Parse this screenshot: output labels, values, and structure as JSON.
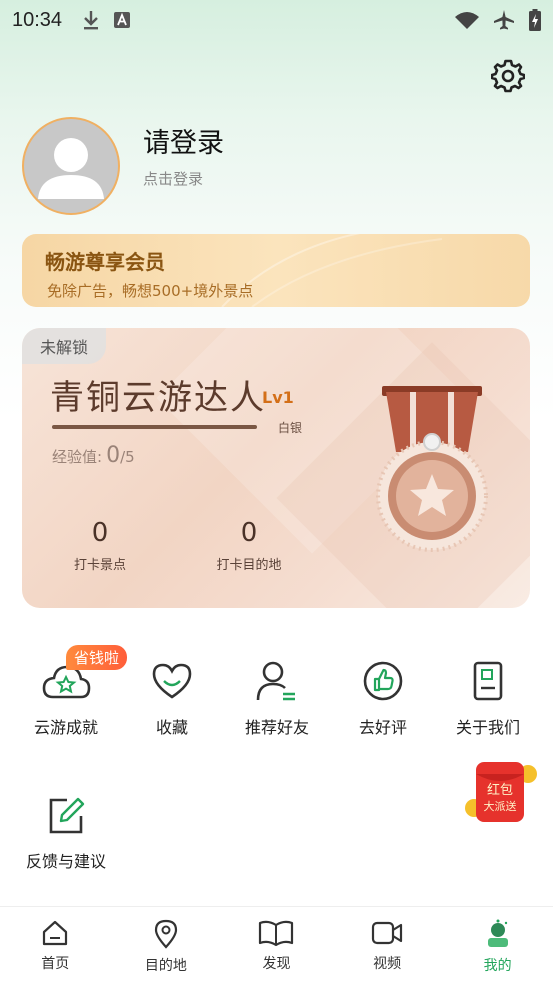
{
  "status_bar": {
    "time": "10:34"
  },
  "profile": {
    "title": "请登录",
    "subtitle": "点击登录"
  },
  "vip": {
    "title": "畅游尊享会员",
    "subtitle": "免除广告，畅想500+境外景点"
  },
  "badge": {
    "locked_label": "未解锁",
    "title": "青铜云游达人",
    "level": "Lv1",
    "next_level": "白银",
    "exp_label": "经验值:",
    "exp_value": "0",
    "exp_max": "/5",
    "progress": 0,
    "stats": [
      {
        "value": "0",
        "label": "打卡景点"
      },
      {
        "value": "0",
        "label": "打卡目的地"
      }
    ]
  },
  "menu": {
    "save_tag": "省钱啦",
    "items": [
      {
        "label": "云游成就",
        "icon": "cloud-star-icon"
      },
      {
        "label": "收藏",
        "icon": "heart-icon"
      },
      {
        "label": "推荐好友",
        "icon": "user-add-icon"
      },
      {
        "label": "去好评",
        "icon": "thumbs-up-icon"
      },
      {
        "label": "关于我们",
        "icon": "info-doc-icon"
      },
      {
        "label": "反馈与建议",
        "icon": "edit-icon"
      }
    ]
  },
  "redpacket": {
    "line1": "红包",
    "line2": "大派送"
  },
  "tabs": [
    {
      "label": "首页",
      "icon": "home-icon",
      "active": false
    },
    {
      "label": "目的地",
      "icon": "location-icon",
      "active": false
    },
    {
      "label": "发现",
      "icon": "book-icon",
      "active": false
    },
    {
      "label": "视频",
      "icon": "video-icon",
      "active": false
    },
    {
      "label": "我的",
      "icon": "profile-icon",
      "active": true
    }
  ],
  "colors": {
    "accent": "#22a55b",
    "vip_text": "#8a5512",
    "badge_text": "#5c3b2c",
    "level": "#d36f18"
  }
}
